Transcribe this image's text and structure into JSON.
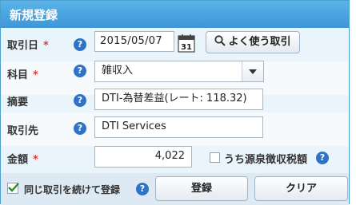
{
  "title": "新規登録",
  "rows": {
    "date": {
      "label": "取引日",
      "required": "*",
      "value": "2015/05/07",
      "calendar_day": "31",
      "often_used_button": "よく使う取引"
    },
    "account": {
      "label": "科目",
      "required": "*",
      "value": "雑収入"
    },
    "description": {
      "label": "摘要",
      "value": "DTI-為替差益(レート: 118.32)"
    },
    "partner": {
      "label": "取引先",
      "value": "DTI Services"
    },
    "amount": {
      "label": "金額",
      "required": "*",
      "value": "4,022",
      "withholding_label": "うち源泉徴収税額"
    }
  },
  "bottom": {
    "continue_label": "同じ取引を続けて登録",
    "continue_checked": true,
    "register_button": "登録",
    "clear_button": "クリア"
  },
  "help_glyph": "?",
  "colors": {
    "title_bar": "#3e96d6",
    "help_icon": "#2f73c7",
    "required": "#e33c3c",
    "check": "#2e8b2e"
  }
}
